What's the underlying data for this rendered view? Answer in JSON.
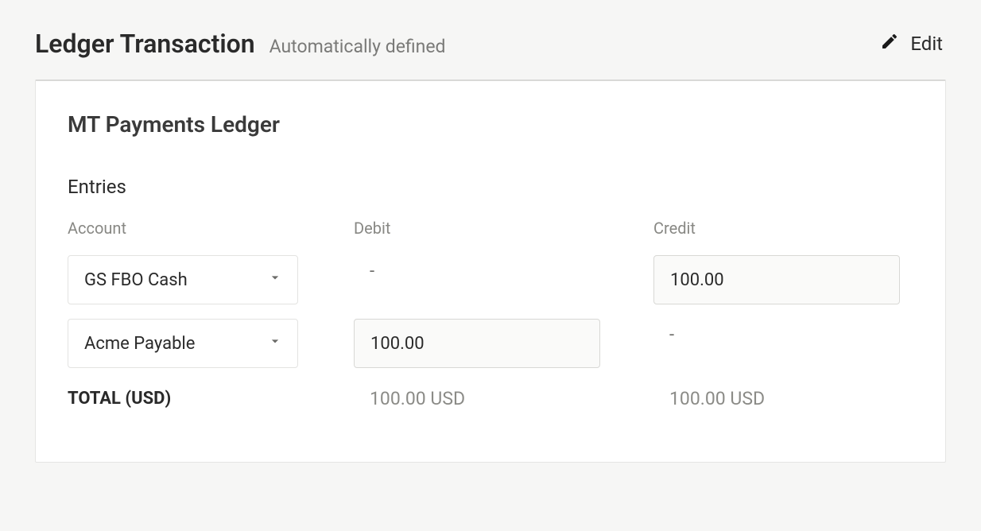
{
  "header": {
    "title": "Ledger Transaction",
    "subtitle": "Automatically defined",
    "edit_label": "Edit"
  },
  "card": {
    "title": "MT Payments Ledger",
    "entries_label": "Entries",
    "columns": {
      "account": "Account",
      "debit": "Debit",
      "credit": "Credit"
    },
    "rows": [
      {
        "account": "GS FBO Cash",
        "debit": "-",
        "credit": "100.00"
      },
      {
        "account": "Acme Payable",
        "debit": "100.00",
        "credit": "-"
      }
    ],
    "total": {
      "label": "TOTAL (USD)",
      "debit": "100.00 USD",
      "credit": "100.00 USD"
    }
  }
}
